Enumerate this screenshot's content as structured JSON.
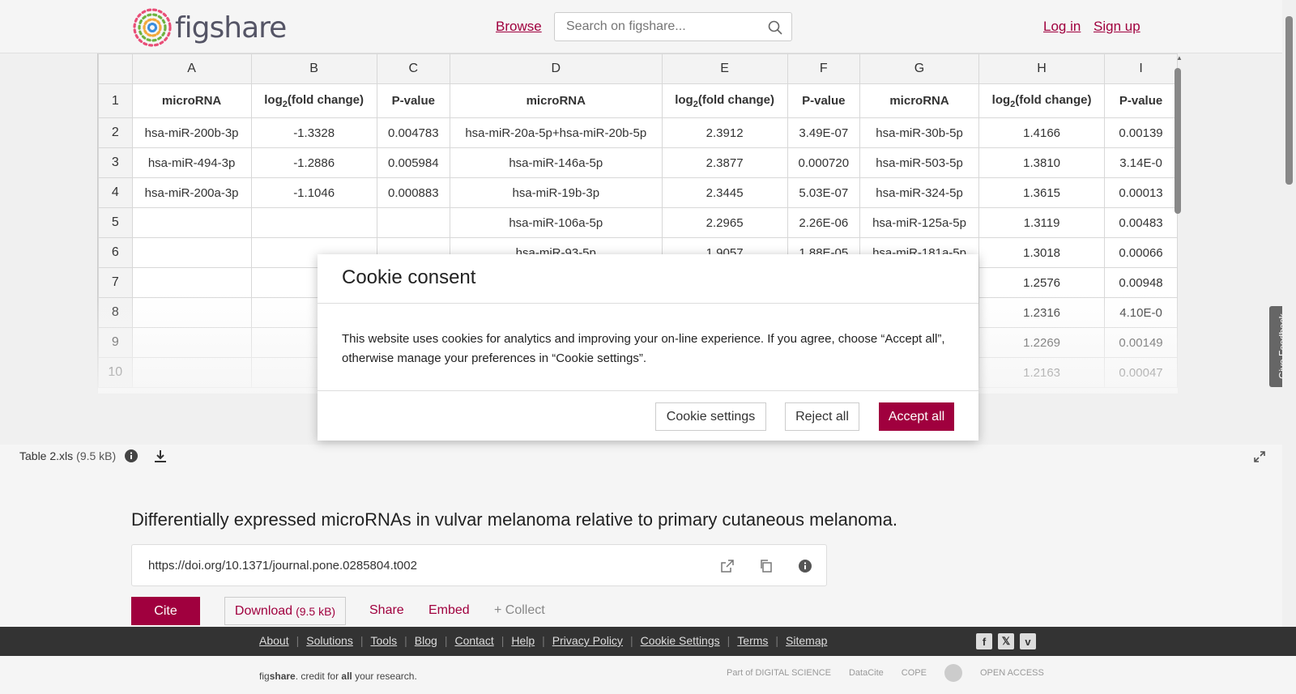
{
  "header": {
    "logo_text": "figshare",
    "browse": "Browse",
    "search_placeholder": "Search on figshare...",
    "login": "Log in",
    "signup": "Sign up"
  },
  "sheet": {
    "columns": [
      "A",
      "B",
      "C",
      "D",
      "E",
      "F",
      "G",
      "H",
      "I"
    ],
    "header_row": [
      "microRNA",
      "log2(fold change)",
      "P-value",
      "microRNA",
      "log2(fold change)",
      "P-value",
      "microRNA",
      "log2(fold change)",
      "P-value"
    ],
    "rows": [
      [
        "hsa-miR-200b-3p",
        "-1.3328",
        "0.004783",
        "hsa-miR-20a-5p+hsa-miR-20b-5p",
        "2.3912",
        "3.49E-07",
        "hsa-miR-30b-5p",
        "1.4166",
        "0.00139"
      ],
      [
        "hsa-miR-494-3p",
        "-1.2886",
        "0.005984",
        "hsa-miR-146a-5p",
        "2.3877",
        "0.000720",
        "hsa-miR-503-5p",
        "1.3810",
        "3.14E-0"
      ],
      [
        "hsa-miR-200a-3p",
        "-1.1046",
        "0.000883",
        "hsa-miR-19b-3p",
        "2.3445",
        "5.03E-07",
        "hsa-miR-324-5p",
        "1.3615",
        "0.00013"
      ],
      [
        "",
        "",
        "",
        "hsa-miR-106a-5p",
        "2.2965",
        "2.26E-06",
        "hsa-miR-125a-5p",
        "1.3119",
        "0.00483"
      ],
      [
        "",
        "",
        "",
        "hsa-miR-93-5p",
        "1.9057",
        "1.88E-05",
        "hsa-miR-181a-5p",
        "1.3018",
        "0.00066"
      ],
      [
        "",
        "",
        "",
        "",
        "",
        "",
        "",
        "1.2576",
        "0.00948"
      ],
      [
        "",
        "",
        "",
        "",
        "",
        "",
        "",
        "1.2316",
        "4.10E-0"
      ],
      [
        "",
        "",
        "",
        "",
        "",
        "",
        "",
        "1.2269",
        "0.00149"
      ],
      [
        "",
        "",
        "",
        "",
        "",
        "",
        "",
        "1.2163",
        "0.00047"
      ]
    ]
  },
  "file": {
    "name": "Table 2.xls",
    "size": "(9.5 kB)"
  },
  "feedback": "Give Feedback",
  "main": {
    "title": "Differentially expressed microRNAs in vulvar melanoma relative to primary cutaneous melanoma.",
    "doi": "https://doi.org/10.1371/journal.pone.0285804.t002",
    "cite": "Cite",
    "download": "Download",
    "download_size": "(9.5 kB)",
    "share": "Share",
    "embed": "Embed",
    "collect": "+ Collect"
  },
  "footer": {
    "links": [
      "About",
      "Solutions",
      "Tools",
      "Blog",
      "Contact",
      "Help",
      "Privacy Policy",
      "Cookie Settings",
      "Terms",
      "Sitemap"
    ],
    "tagline_a": "fig",
    "tagline_b": "share",
    "tagline_c": ". credit for ",
    "tagline_d": "all",
    "tagline_e": " your research.",
    "partners": [
      "Part of DIGITAL SCIENCE",
      "DataCite",
      "COPE",
      "",
      "OPEN ACCESS"
    ]
  },
  "cookie": {
    "title": "Cookie consent",
    "body": "This website uses cookies for analytics and improving your on-line experience. If you agree, choose “Accept all”, otherwise manage your preferences in “Cookie settings”.",
    "settings": "Cookie settings",
    "reject": "Reject all",
    "accept": "Accept all"
  },
  "colors": {
    "brand": "#a0003e",
    "footer_bg": "#333333"
  }
}
